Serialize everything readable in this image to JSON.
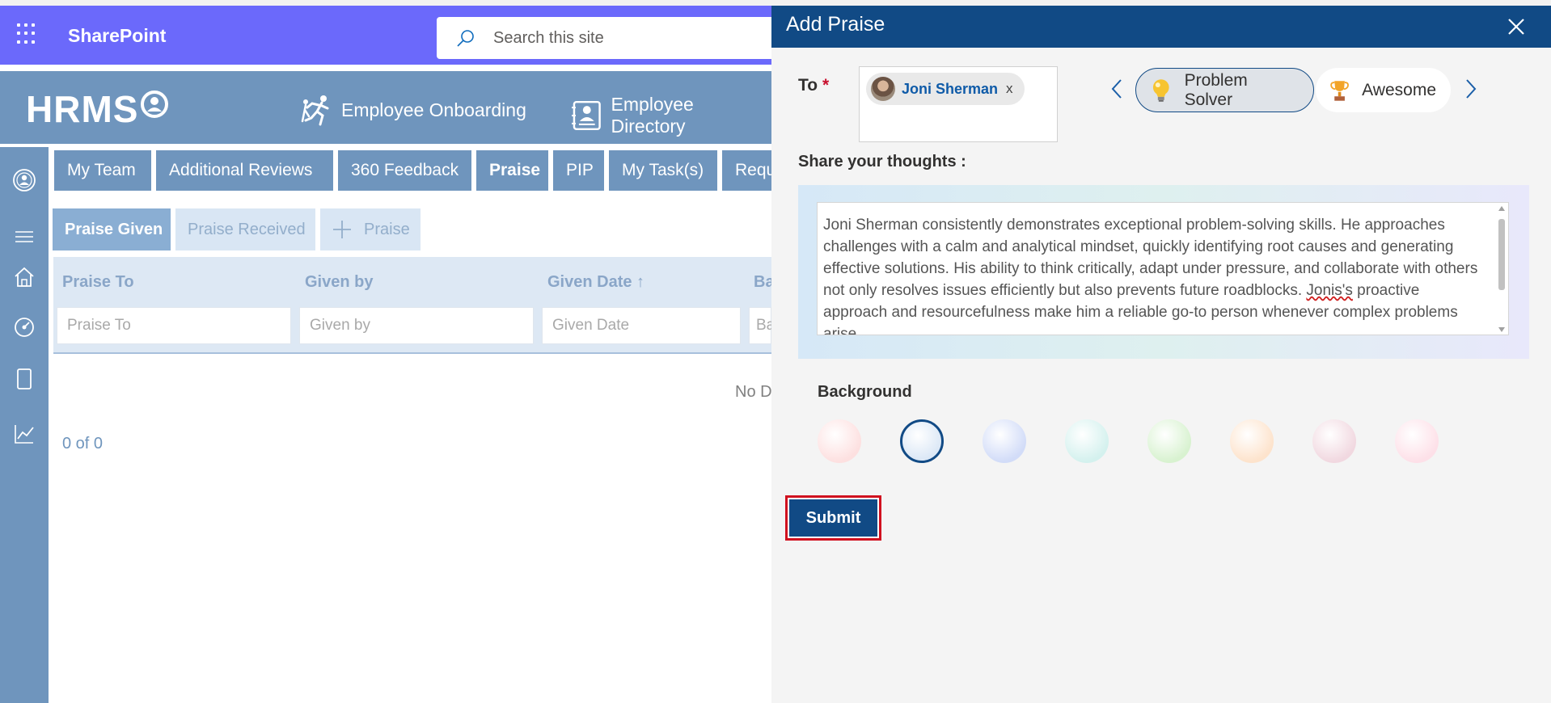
{
  "suite_bar": {
    "app_name": "SharePoint",
    "search_placeholder": "Search this site",
    "icons": {
      "waffle": "waffle-icon",
      "search": "search-icon"
    },
    "color": "#6b69fb"
  },
  "hrms_header": {
    "logo_text": "HRMS",
    "links": [
      {
        "label": "Employee Onboarding",
        "icon": "onboarding-icon"
      },
      {
        "label": "Employee Directory",
        "icon": "directory-icon"
      }
    ],
    "color": "#6f95bd"
  },
  "left_rail": {
    "icons": [
      "profile-icon",
      "menu-icon",
      "home-icon",
      "dashboard-icon",
      "tablet-icon",
      "chart-icon"
    ]
  },
  "tabs": [
    {
      "label": "My Team"
    },
    {
      "label": "Additional Reviews"
    },
    {
      "label": "360 Feedback"
    },
    {
      "label": "Praise",
      "active": true
    },
    {
      "label": "PIP"
    },
    {
      "label": "My Task(s)"
    },
    {
      "label": "Requ"
    }
  ],
  "subtabs": {
    "given": "Praise Given",
    "received": "Praise Received",
    "add": "Praise"
  },
  "grid": {
    "columns": [
      "Praise To",
      "Given by",
      "Given Date ↑",
      "Ba"
    ],
    "filter_placeholders": [
      "Praise To",
      "Given by",
      "Given Date",
      "Ba"
    ],
    "empty_text": "No D",
    "pager": "0 of 0"
  },
  "panel": {
    "title": "Add Praise",
    "to_label": "To",
    "required_mark": "*",
    "recipient": {
      "name": "Joni Sherman",
      "remove": "x"
    },
    "badges": [
      {
        "label": "Problem Solver",
        "icon": "lightbulb-icon",
        "selected": true
      },
      {
        "label": "Awesome",
        "icon": "trophy-icon",
        "selected": false
      }
    ],
    "share_label": "Share your thoughts :",
    "thoughts_text_1": "Joni Sherman consistently demonstrates exceptional problem-solving skills. He approaches challenges with a calm and analytical mindset, quickly identifying root causes and generating effective solutions. His ability to think critically, adapt under pressure, and collaborate with others not only resolves issues efficiently but also prevents future roadblocks. ",
    "thoughts_text_misspelled": "Jonis's",
    "thoughts_text_2": " proactive approach and resourcefulness make him a reliable go-to person whenever complex problems arise.",
    "background_label": "Background",
    "background_swatches": [
      "#fde0e0",
      "#dce8f6",
      "#d2dcf8",
      "#d4f1ee",
      "#d8f2d0",
      "#fde3cc",
      "#f1d8e0",
      "#fde0e8"
    ],
    "selected_swatch_index": 1,
    "submit_label": "Submit",
    "header_color": "#114a85"
  }
}
